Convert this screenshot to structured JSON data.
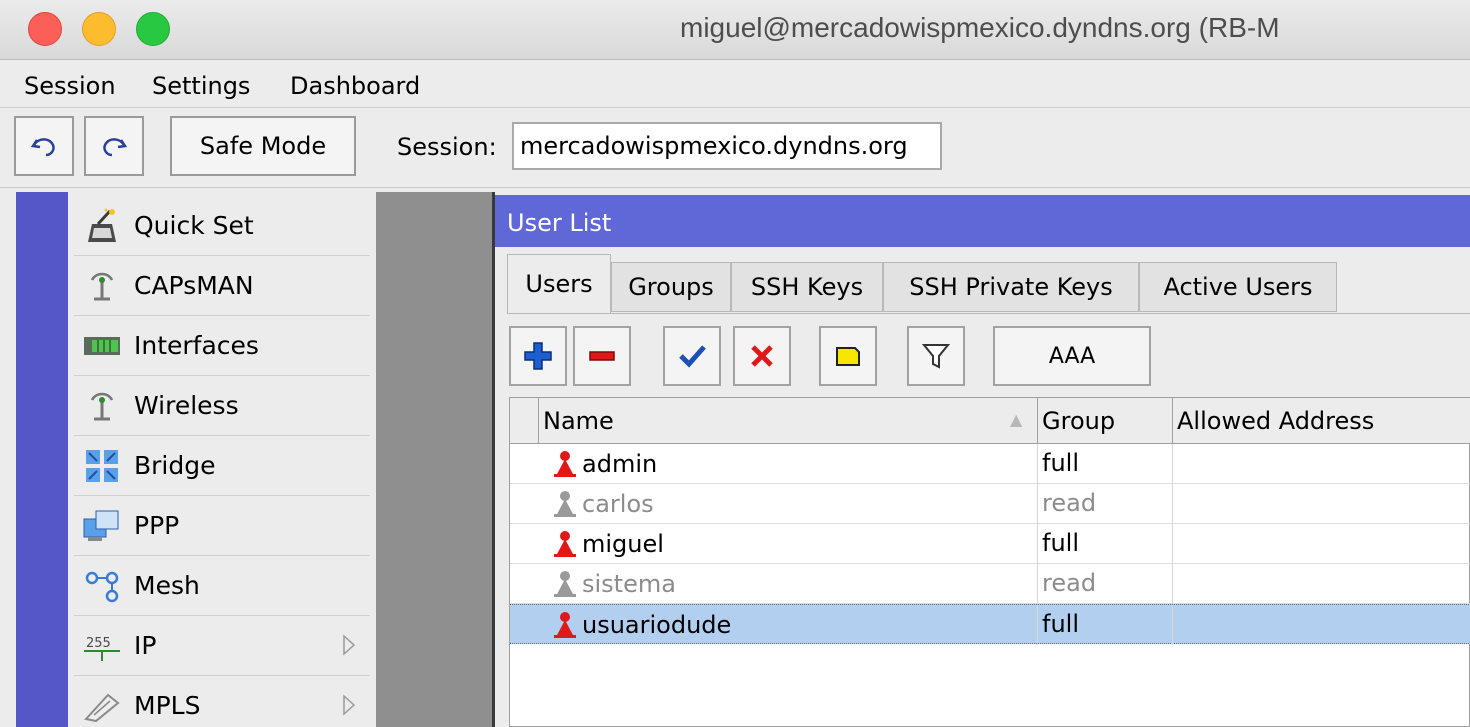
{
  "window": {
    "title": "miguel@mercadowispmexico.dyndns.org (RB-M"
  },
  "menubar": {
    "items": [
      "Session",
      "Settings",
      "Dashboard"
    ]
  },
  "toolbar": {
    "undo_icon": "undo-icon",
    "redo_icon": "redo-icon",
    "safe_mode_label": "Safe Mode",
    "session_label": "Session:",
    "session_value": "mercadowispmexico.dyndns.org"
  },
  "sidebar": {
    "accent_color": "#5557c9",
    "items": [
      {
        "label": "Quick Set",
        "icon": "wand-icon"
      },
      {
        "label": "CAPsMAN",
        "icon": "antenna-icon"
      },
      {
        "label": "Interfaces",
        "icon": "interfaces-icon"
      },
      {
        "label": "Wireless",
        "icon": "antenna-icon"
      },
      {
        "label": "Bridge",
        "icon": "bridge-icon"
      },
      {
        "label": "PPP",
        "icon": "ppp-icon"
      },
      {
        "label": "Mesh",
        "icon": "mesh-icon"
      },
      {
        "label": "IP",
        "icon": "ip-icon"
      },
      {
        "label": "MPLS",
        "icon": "mpls-icon"
      }
    ]
  },
  "user_list": {
    "title": "User List",
    "title_color": "#6067d6",
    "tabs": [
      "Users",
      "Groups",
      "SSH Keys",
      "SSH Private Keys",
      "Active Users"
    ],
    "active_tab": "Users",
    "actions": {
      "add_icon": "plus-icon",
      "remove_icon": "minus-icon",
      "enable_icon": "check-icon",
      "disable_icon": "x-icon",
      "comment_icon": "comment-icon",
      "filter_icon": "filter-icon",
      "aaa_label": "AAA"
    },
    "columns": [
      "Name",
      "Group",
      "Allowed Address"
    ],
    "rows": [
      {
        "name": "admin",
        "group": "full",
        "allowed_address": "",
        "enabled": true,
        "selected": false
      },
      {
        "name": "carlos",
        "group": "read",
        "allowed_address": "",
        "enabled": false,
        "selected": false
      },
      {
        "name": "miguel",
        "group": "full",
        "allowed_address": "",
        "enabled": true,
        "selected": false
      },
      {
        "name": "sistema",
        "group": "read",
        "allowed_address": "",
        "enabled": false,
        "selected": false
      },
      {
        "name": "usuariodude",
        "group": "full",
        "allowed_address": "",
        "enabled": true,
        "selected": true
      }
    ]
  }
}
